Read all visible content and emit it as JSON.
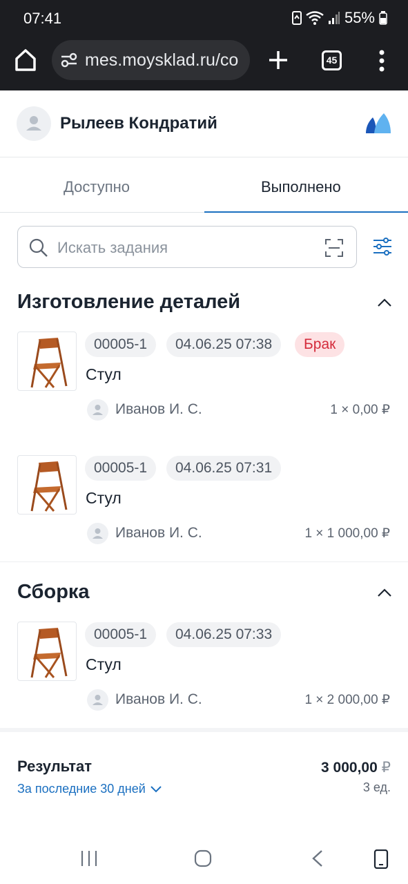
{
  "status_bar": {
    "time": "07:41",
    "battery": "55%"
  },
  "browser": {
    "url": "mes.moysklad.ru/co",
    "tab_count": "45"
  },
  "header": {
    "user_name": "Рылеев Кондратий"
  },
  "tabs": [
    {
      "label": "Доступно",
      "active": false
    },
    {
      "label": "Выполнено",
      "active": true
    }
  ],
  "search": {
    "placeholder": "Искать задания"
  },
  "sections": [
    {
      "title": "Изготовление деталей",
      "tasks": [
        {
          "id": "00005-1",
          "date": "04.06.25 07:38",
          "badge": "Брак",
          "name": "Стул",
          "worker": "Иванов И. С.",
          "price": "1 × 0,00 ₽"
        },
        {
          "id": "00005-1",
          "date": "04.06.25 07:31",
          "name": "Стул",
          "worker": "Иванов И. С.",
          "price": "1 × 1 000,00 ₽"
        }
      ]
    },
    {
      "title": "Сборка",
      "tasks": [
        {
          "id": "00005-1",
          "date": "04.06.25 07:33",
          "name": "Стул",
          "worker": "Иванов И. С.",
          "price": "1 × 2 000,00 ₽"
        }
      ]
    }
  ],
  "result": {
    "title": "Результат",
    "period": "За последние 30 дней",
    "sum": "3 000,00",
    "currency": "₽",
    "quantity": "3 ед."
  },
  "colors": {
    "accent": "#1a6fc0",
    "defect_bg": "#fde2e4",
    "defect_text": "#d42b3b",
    "chrome_bg": "#1c1d21"
  }
}
